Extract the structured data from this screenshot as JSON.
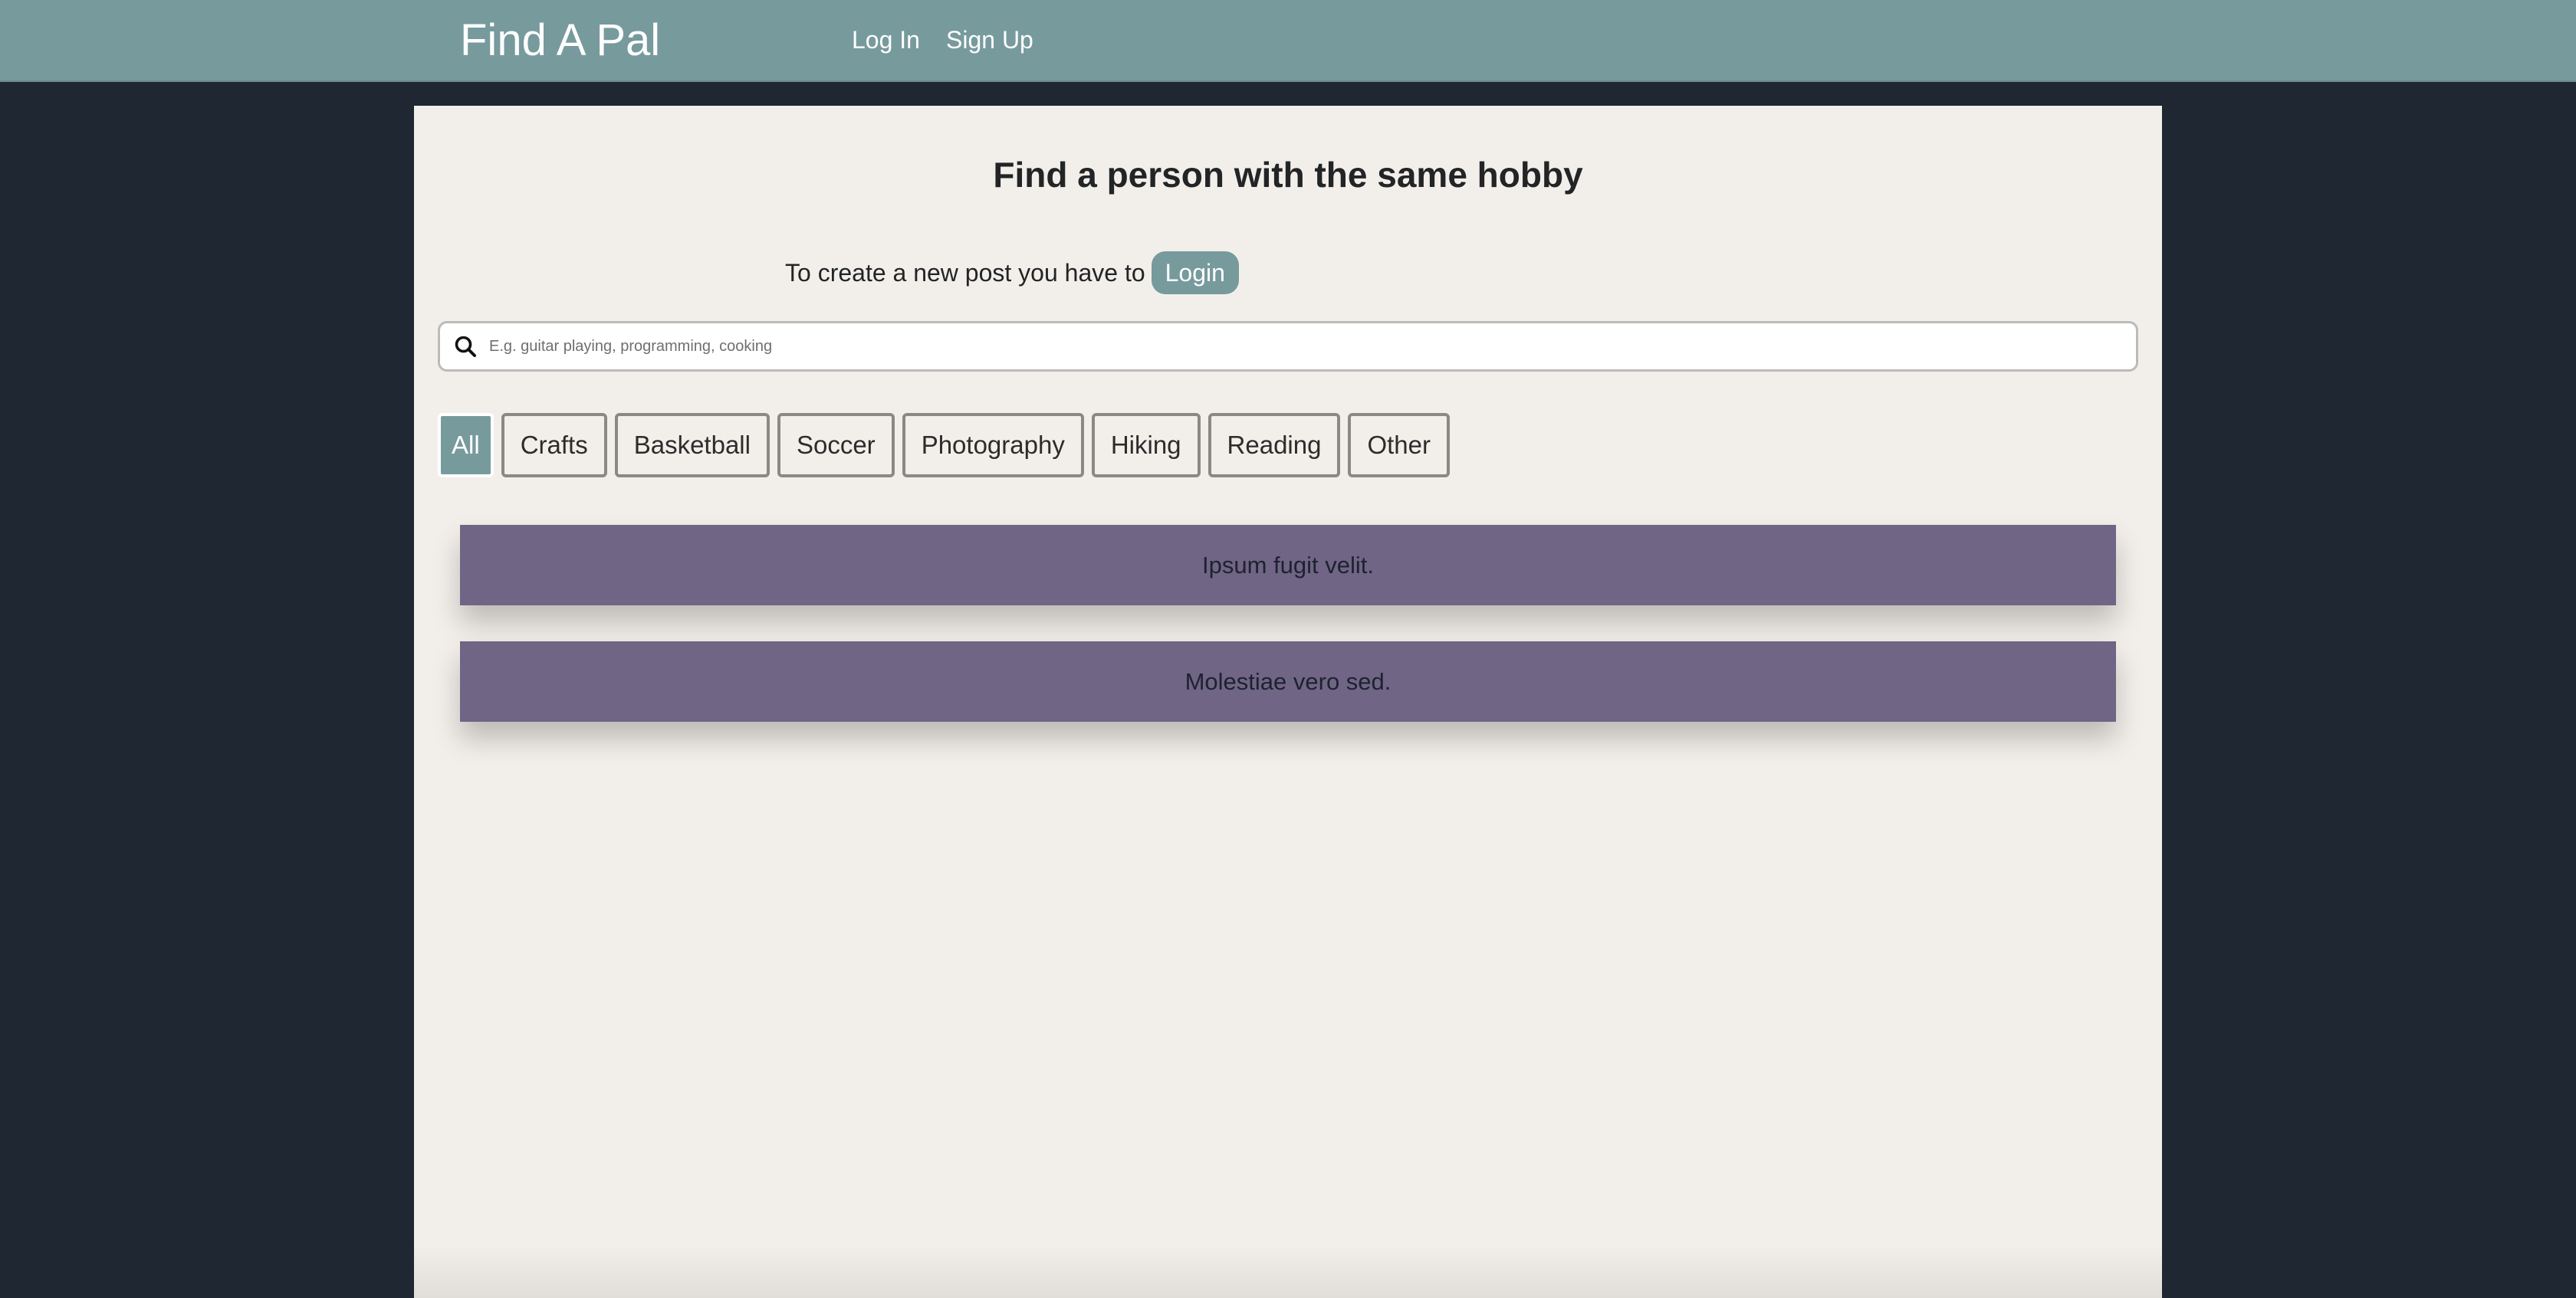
{
  "navbar": {
    "brand": "Find A Pal",
    "links": [
      {
        "label": "Log In"
      },
      {
        "label": "Sign Up"
      }
    ]
  },
  "main": {
    "title": "Find a person with the same hobby",
    "create_note": "To create a new post you have to",
    "login_button": "Login",
    "search": {
      "placeholder": "E.g. guitar playing, programming, cooking",
      "value": ""
    },
    "filters": [
      {
        "label": "All",
        "active": true
      },
      {
        "label": "Crafts",
        "active": false
      },
      {
        "label": "Basketball",
        "active": false
      },
      {
        "label": "Soccer",
        "active": false
      },
      {
        "label": "Photography",
        "active": false
      },
      {
        "label": "Hiking",
        "active": false
      },
      {
        "label": "Reading",
        "active": false
      },
      {
        "label": "Other",
        "active": false
      }
    ],
    "posts": [
      {
        "title": "Ipsum fugit velit."
      },
      {
        "title": "Molestiae vero sed."
      }
    ]
  },
  "colors": {
    "background": "#1f2733",
    "navbar": "#779a9d",
    "panel": "#f2efea",
    "post": "#706585",
    "accent": "#779a9d"
  },
  "icons": {
    "search": "search-icon"
  }
}
